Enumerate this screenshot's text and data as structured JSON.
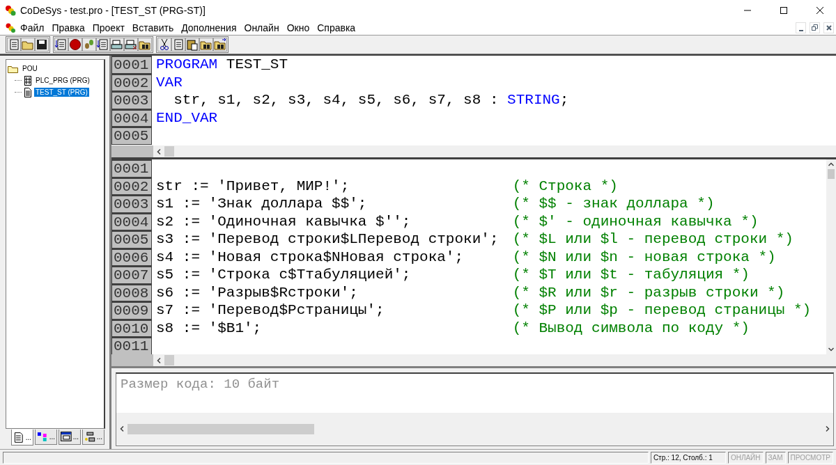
{
  "window": {
    "title": "CoDeSys - test.pro - [TEST_ST (PRG-ST)]"
  },
  "menu": [
    {
      "label": "Файл"
    },
    {
      "label": "Правка"
    },
    {
      "label": "Проект"
    },
    {
      "label": "Вставить"
    },
    {
      "label": "Дополнения"
    },
    {
      "label": "Онлайн"
    },
    {
      "label": "Окно"
    },
    {
      "label": "Справка"
    }
  ],
  "tree": {
    "label": "POU",
    "expanded": true,
    "children": [
      {
        "label": "PLC_PRG (PRG)",
        "kind": "ladder",
        "selected": false
      },
      {
        "label": "TEST_ST (PRG)",
        "kind": "text",
        "selected": true
      }
    ]
  },
  "panel_tabs": [
    {
      "label": "...",
      "selected": true
    },
    {
      "label": "...",
      "selected": false
    },
    {
      "label": "...",
      "selected": false
    },
    {
      "label": "...",
      "selected": false
    }
  ],
  "declaration": {
    "lines": [
      {
        "number": "0001",
        "segments": [
          {
            "kind": "keyword",
            "text": "PROGRAM"
          },
          {
            "kind": "plain",
            "text": " TEST_ST"
          }
        ]
      },
      {
        "number": "0002",
        "segments": [
          {
            "kind": "keyword",
            "text": "VAR"
          }
        ]
      },
      {
        "number": "0003",
        "segments": [
          {
            "kind": "plain",
            "text": "  str, s1, s2, s3, s4, s5, s6, s7, s8 : "
          },
          {
            "kind": "keyword",
            "text": "STRING"
          },
          {
            "kind": "plain",
            "text": ";"
          }
        ]
      },
      {
        "number": "0004",
        "segments": [
          {
            "kind": "keyword",
            "text": "END_VAR"
          }
        ]
      },
      {
        "number": "0005"
      }
    ]
  },
  "body": {
    "lines": [
      {
        "number": "0001"
      },
      {
        "number": "0002",
        "code": "str := 'Привет, МИР!';",
        "comment": "(* Строка *)"
      },
      {
        "number": "0003",
        "code": "s1 := 'Знак доллара $$';",
        "comment": "(* $$ - знак доллара *)"
      },
      {
        "number": "0004",
        "code": "s2 := 'Одиночная кавычка $'';",
        "comment": "(* $' - одиночная кавычка *)"
      },
      {
        "number": "0005",
        "code": "s3 := 'Перевод строки$LПеревод строки';",
        "comment": "(* $L или $l - перевод строки *)"
      },
      {
        "number": "0006",
        "code": "s4 := 'Новая строка$NНовая строка';",
        "comment": "(* $N или $n - новая строка *)"
      },
      {
        "number": "0007",
        "code": "s5 := 'Строка с$Tтабуляцией';",
        "comment": "(* $T или $t - табуляция *)"
      },
      {
        "number": "0008",
        "code": "s6 := 'Разрыв$Rстроки';",
        "comment": "(* $R или $r - разрыв строки *)"
      },
      {
        "number": "0009",
        "code": "s7 := 'Перевод$Pстраницы';",
        "comment": "(* $P или $p - перевод страницы *)"
      },
      {
        "number": "0010",
        "code": "s8 := '$B1';",
        "comment": "(* Вывод символа по коду *)"
      },
      {
        "number": "0011"
      }
    ]
  },
  "messages": [
    "Размер кода: 10 байт"
  ],
  "status_bar": [
    {
      "text": "Стр.: 12, Столб.: 1",
      "disabled": false
    },
    {
      "text": "ОНЛАЙН",
      "disabled": true
    },
    {
      "text": "ЗАМ",
      "disabled": true
    },
    {
      "text": "ПРОСМОТР",
      "disabled": true
    }
  ]
}
